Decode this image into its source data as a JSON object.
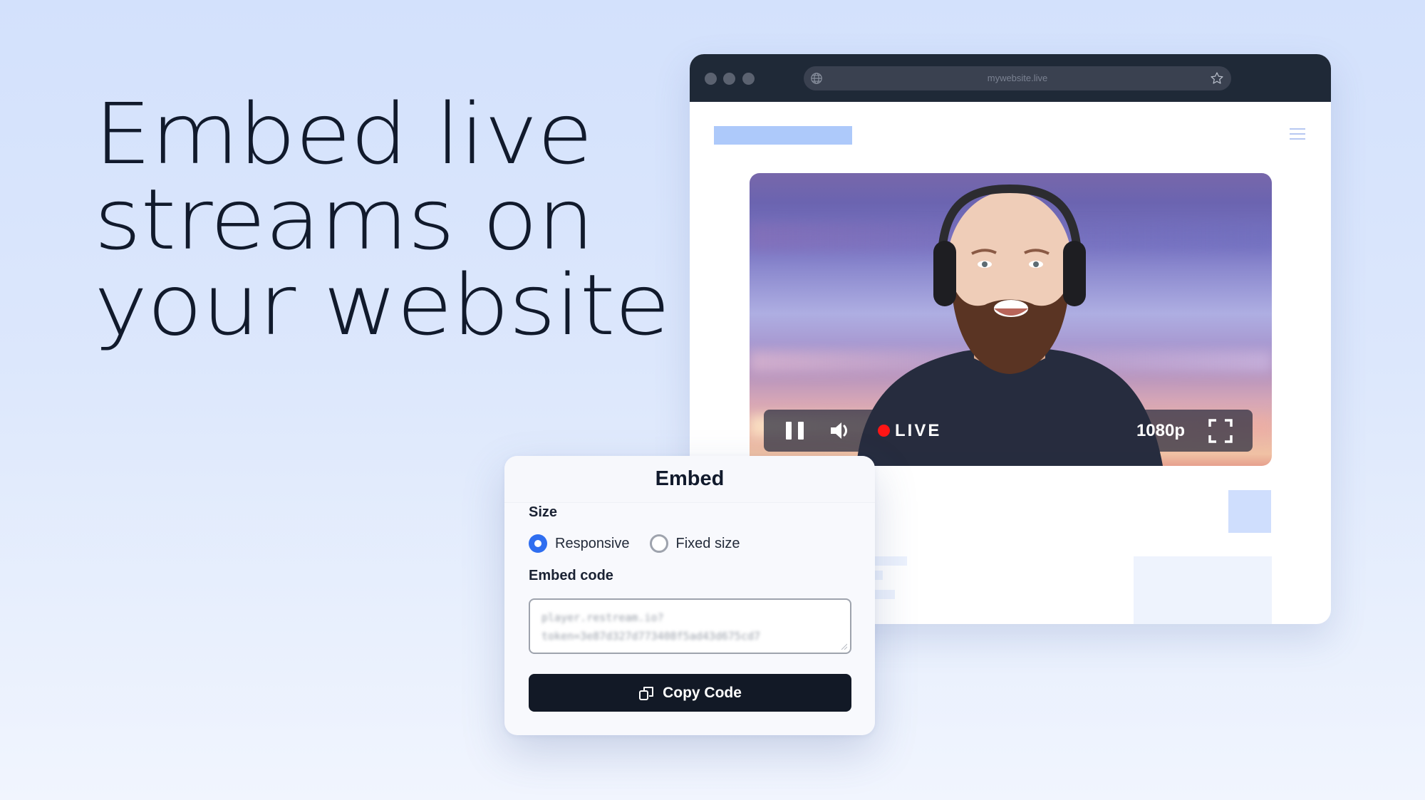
{
  "headline": {
    "lines": [
      "Embed live",
      "streams on",
      "your website"
    ]
  },
  "browser": {
    "url": "mywebsite.live",
    "icons": {
      "globe": "globe-icon",
      "bookmark": "star-icon",
      "menu": "hamburger-menu-icon"
    }
  },
  "player": {
    "live_label": "LIVE",
    "quality": "1080p",
    "icons": {
      "pause": "pause-icon",
      "volume": "volume-icon",
      "live_indicator": "live-dot-icon",
      "fullscreen": "fullscreen-icon"
    },
    "colors": {
      "live_dot": "#ff1515"
    }
  },
  "embed": {
    "title": "Embed",
    "size_label": "Size",
    "size_options": [
      {
        "label": "Responsive",
        "selected": true
      },
      {
        "label": "Fixed size",
        "selected": false
      }
    ],
    "code_label": "Embed code",
    "code_value_lines": [
      "player.restream.io?",
      "token=3e87d327d773408f5ad43d675cd7"
    ],
    "copy_button": "Copy Code",
    "colors": {
      "radio_selected": "#2f6ef0",
      "button_bg": "#121926"
    }
  }
}
